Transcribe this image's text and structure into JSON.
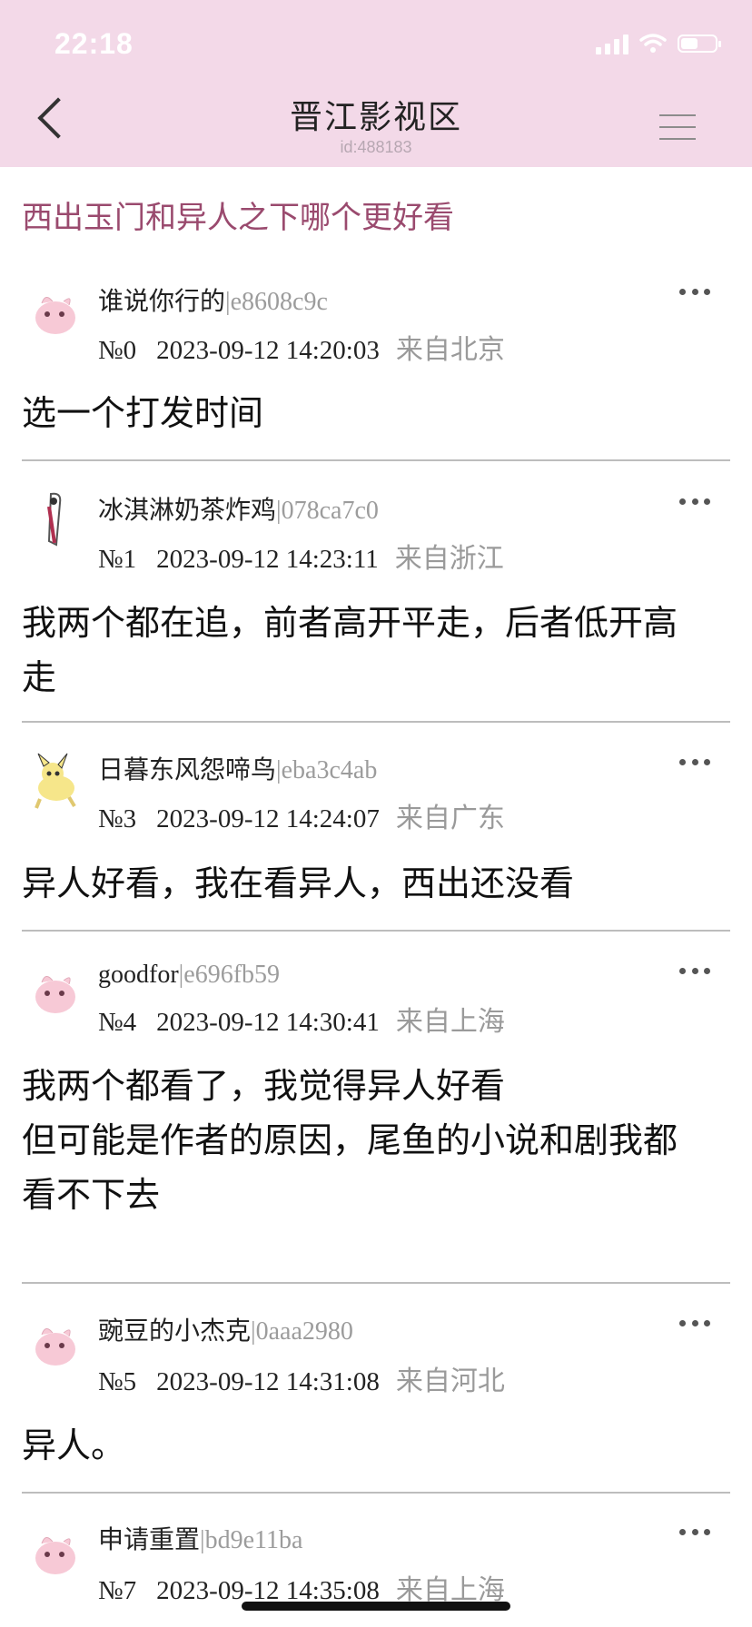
{
  "status_bar": {
    "time": "22:18"
  },
  "nav": {
    "title": "晋江影视区",
    "sub_id": "id:488183"
  },
  "thread": {
    "title": "西出玉门和异人之下哪个更好看"
  },
  "posts": [
    {
      "name": "谁说你行的",
      "uid": "|e8608c9c",
      "num": "№0",
      "time": "2023-09-12 14:20:03",
      "loc": "来自北京",
      "content": "选一个打发时间",
      "avatar": "pink-creature-avatar"
    },
    {
      "name": "冰淇淋奶茶炸鸡",
      "uid": "|078ca7c0",
      "num": "№1",
      "time": "2023-09-12 14:23:11",
      "loc": "来自浙江",
      "content": "我两个都在追，前者高开平走，后者低开高\n走",
      "avatar": "figure-avatar"
    },
    {
      "name": "日暮东风怨啼鸟",
      "uid": "|eba3c4ab",
      "num": "№3",
      "time": "2023-09-12 14:24:07",
      "loc": "来自广东",
      "content": "异人好看，我在看异人，西出还没看",
      "avatar": "yellow-creature-avatar"
    },
    {
      "name": "goodfor",
      "uid": "|e696fb59",
      "num": "№4",
      "time": "2023-09-12 14:30:41",
      "loc": "来自上海",
      "content": "我两个都看了，我觉得异人好看\n但可能是作者的原因，尾鱼的小说和剧我都\n看不下去",
      "avatar": "pink-creature-avatar"
    },
    {
      "name": "豌豆的小杰克",
      "uid": "|0aaa2980",
      "num": "№5",
      "time": "2023-09-12 14:31:08",
      "loc": "来自河北",
      "content": "异人。",
      "avatar": "pink-creature-avatar"
    },
    {
      "name": "申请重置",
      "uid": "|bd9e11ba",
      "num": "№7",
      "time": "2023-09-12 14:35:08",
      "loc": "来自上海",
      "content": "",
      "avatar": "pink-creature-avatar"
    }
  ],
  "colors": {
    "header_bg": "#f3d9e8",
    "thread_title": "#9a4a6e",
    "meta_grey": "#9a9a9a"
  }
}
